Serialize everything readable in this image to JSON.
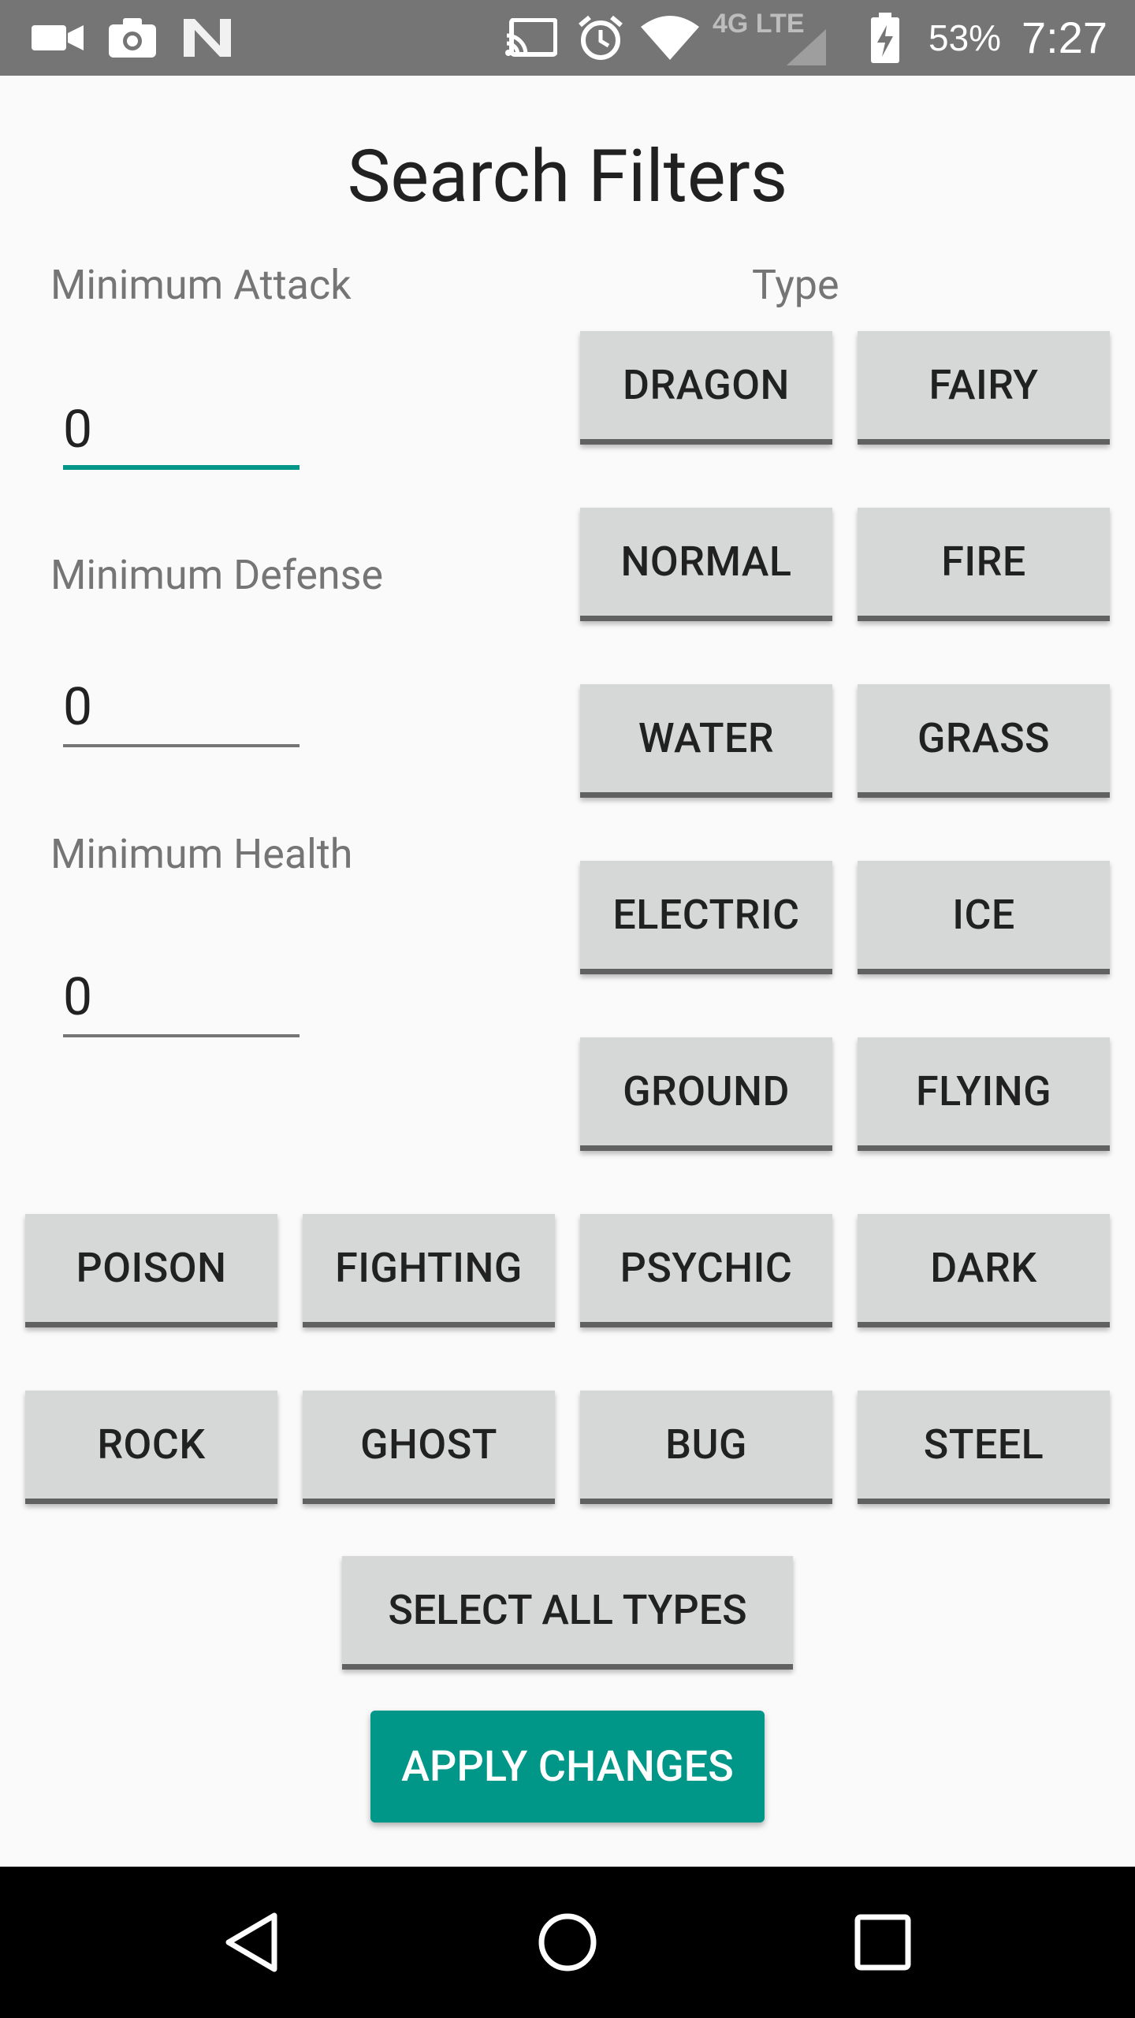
{
  "status_bar": {
    "icons": [
      "video-icon",
      "camera-icon",
      "n-icon",
      "cast-icon",
      "alarm-icon",
      "wifi-icon",
      "signal-4g-icon",
      "battery-charging-icon"
    ],
    "network": "4G LTE",
    "battery": "53%",
    "time": "7:27"
  },
  "title": "Search Filters",
  "fields": {
    "attack": {
      "label": "Minimum Attack",
      "value": "0"
    },
    "defense": {
      "label": "Minimum Defense",
      "value": "0"
    },
    "health": {
      "label": "Minimum Health",
      "value": "0"
    }
  },
  "type_label": "Type",
  "types": [
    "DRAGON",
    "FAIRY",
    "NORMAL",
    "FIRE",
    "WATER",
    "GRASS",
    "ELECTRIC",
    "ICE",
    "GROUND",
    "FLYING",
    "POISON",
    "FIGHTING",
    "PSYCHIC",
    "DARK",
    "ROCK",
    "GHOST",
    "BUG",
    "STEEL"
  ],
  "select_all_label": "SELECT ALL TYPES",
  "apply_label": "APPLY CHANGES",
  "colors": {
    "accent": "#009688",
    "status_bar": "#757575",
    "button_bg": "#d6d7d7",
    "background": "#fafafa"
  },
  "nav_bar": {
    "icons": [
      "back-icon",
      "home-icon",
      "recents-icon"
    ]
  }
}
